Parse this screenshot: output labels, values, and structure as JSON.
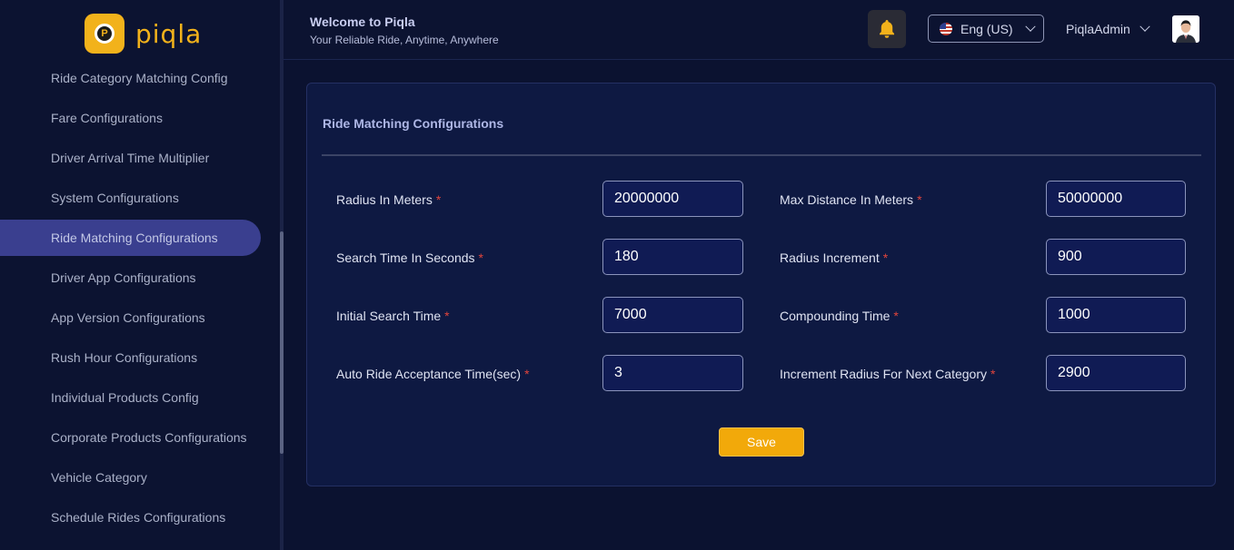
{
  "brand": {
    "name": "piqla",
    "accent": "#f2b21b"
  },
  "sidebar": {
    "items": [
      {
        "label": "Ride Category Matching Config",
        "active": false
      },
      {
        "label": "Fare Configurations",
        "active": false
      },
      {
        "label": "Driver Arrival Time Multiplier",
        "active": false
      },
      {
        "label": "System Configurations",
        "active": false
      },
      {
        "label": "Ride Matching Configurations",
        "active": true
      },
      {
        "label": "Driver App Configurations",
        "active": false
      },
      {
        "label": "App Version Configurations",
        "active": false
      },
      {
        "label": "Rush Hour Configurations",
        "active": false
      },
      {
        "label": "Individual Products Config",
        "active": false
      },
      {
        "label": "Corporate Products Configurations",
        "active": false
      },
      {
        "label": "Vehicle Category",
        "active": false
      },
      {
        "label": "Schedule Rides Configurations",
        "active": false
      }
    ]
  },
  "header": {
    "welcome_title": "Welcome to Piqla",
    "welcome_subtitle": "Your Reliable Ride, Anytime, Anywhere",
    "notification_icon": "bell-icon",
    "language": "Eng (US)",
    "username": "PiqlaAdmin"
  },
  "form": {
    "title": "Ride Matching Configurations",
    "fields": {
      "radius_in_meters": {
        "label": "Radius In Meters",
        "value": "20000000"
      },
      "max_distance_in_meters": {
        "label": "Max Distance In Meters",
        "value": "50000000"
      },
      "search_time_in_seconds": {
        "label": "Search Time In Seconds",
        "value": "180"
      },
      "radius_increment": {
        "label": "Radius Increment",
        "value": "900"
      },
      "initial_search_time": {
        "label": "Initial Search Time",
        "value": "7000"
      },
      "compounding_time": {
        "label": "Compounding Time",
        "value": "1000"
      },
      "auto_ride_acceptance_time": {
        "label": "Auto Ride Acceptance Time(sec)",
        "value": "3"
      },
      "increment_radius_next_category": {
        "label": "Increment Radius For Next Category",
        "value": "2900"
      }
    },
    "required_marker": "*",
    "save_label": "Save"
  }
}
